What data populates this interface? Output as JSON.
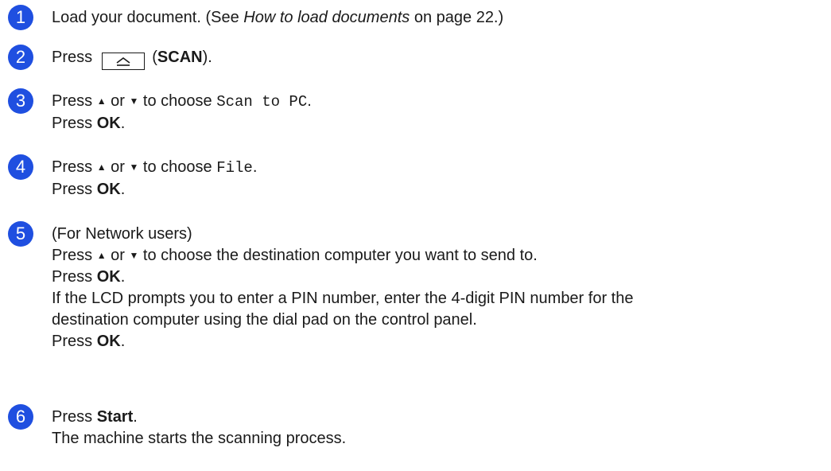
{
  "steps": [
    {
      "number": "1",
      "load_prefix": "Load your document. (See ",
      "load_link": "How to load documents",
      "load_suffix": " on page 22.)"
    },
    {
      "number": "2",
      "press": "Press ",
      "scan_open": " (",
      "scan_label": "SCAN",
      "scan_close": ")."
    },
    {
      "number": "3",
      "press": "Press ",
      "up": "▲",
      "or": " or ",
      "down": "▼",
      "to_choose": " to choose ",
      "option": "Scan to PC",
      "period": ".",
      "press_ok": "Press ",
      "ok": "OK",
      "ok_period": "."
    },
    {
      "number": "4",
      "press": "Press ",
      "up": "▲",
      "or": " or ",
      "down": "▼",
      "to_choose": " to choose ",
      "option": "File",
      "period": ".",
      "press_ok": "Press ",
      "ok": "OK",
      "ok_period": "."
    },
    {
      "number": "5",
      "network_users": "(For Network users)",
      "press": "Press ",
      "up": "▲",
      "or": " or ",
      "down": "▼",
      "dest_text": " to choose the destination computer you want to send to.",
      "press_ok_1": "Press ",
      "ok_1": "OK",
      "ok_period_1": ".",
      "pin_line_1": "If the LCD prompts you to enter a PIN number, enter the 4-digit PIN number for the",
      "pin_line_2": "destination computer using the dial pad on the control panel.",
      "press_ok_2": "Press ",
      "ok_2": "OK",
      "ok_period_2": "."
    },
    {
      "number": "6",
      "press": "Press ",
      "start": "Start",
      "period": ".",
      "process_text": "The machine starts the scanning process."
    }
  ],
  "icons": {
    "scan_key": "scan-key-icon"
  },
  "colors": {
    "badge": "#1f4fe0"
  }
}
